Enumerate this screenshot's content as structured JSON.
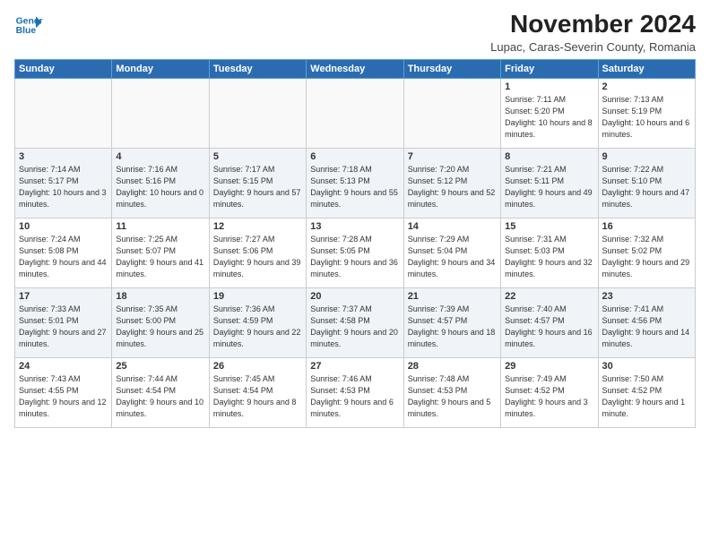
{
  "header": {
    "logo_line1": "General",
    "logo_line2": "Blue",
    "month_title": "November 2024",
    "subtitle": "Lupac, Caras-Severin County, Romania"
  },
  "weekdays": [
    "Sunday",
    "Monday",
    "Tuesday",
    "Wednesday",
    "Thursday",
    "Friday",
    "Saturday"
  ],
  "weeks": [
    [
      {
        "day": "",
        "info": ""
      },
      {
        "day": "",
        "info": ""
      },
      {
        "day": "",
        "info": ""
      },
      {
        "day": "",
        "info": ""
      },
      {
        "day": "",
        "info": ""
      },
      {
        "day": "1",
        "info": "Sunrise: 7:11 AM\nSunset: 5:20 PM\nDaylight: 10 hours\nand 8 minutes."
      },
      {
        "day": "2",
        "info": "Sunrise: 7:13 AM\nSunset: 5:19 PM\nDaylight: 10 hours\nand 6 minutes."
      }
    ],
    [
      {
        "day": "3",
        "info": "Sunrise: 7:14 AM\nSunset: 5:17 PM\nDaylight: 10 hours\nand 3 minutes."
      },
      {
        "day": "4",
        "info": "Sunrise: 7:16 AM\nSunset: 5:16 PM\nDaylight: 10 hours\nand 0 minutes."
      },
      {
        "day": "5",
        "info": "Sunrise: 7:17 AM\nSunset: 5:15 PM\nDaylight: 9 hours\nand 57 minutes."
      },
      {
        "day": "6",
        "info": "Sunrise: 7:18 AM\nSunset: 5:13 PM\nDaylight: 9 hours\nand 55 minutes."
      },
      {
        "day": "7",
        "info": "Sunrise: 7:20 AM\nSunset: 5:12 PM\nDaylight: 9 hours\nand 52 minutes."
      },
      {
        "day": "8",
        "info": "Sunrise: 7:21 AM\nSunset: 5:11 PM\nDaylight: 9 hours\nand 49 minutes."
      },
      {
        "day": "9",
        "info": "Sunrise: 7:22 AM\nSunset: 5:10 PM\nDaylight: 9 hours\nand 47 minutes."
      }
    ],
    [
      {
        "day": "10",
        "info": "Sunrise: 7:24 AM\nSunset: 5:08 PM\nDaylight: 9 hours\nand 44 minutes."
      },
      {
        "day": "11",
        "info": "Sunrise: 7:25 AM\nSunset: 5:07 PM\nDaylight: 9 hours\nand 41 minutes."
      },
      {
        "day": "12",
        "info": "Sunrise: 7:27 AM\nSunset: 5:06 PM\nDaylight: 9 hours\nand 39 minutes."
      },
      {
        "day": "13",
        "info": "Sunrise: 7:28 AM\nSunset: 5:05 PM\nDaylight: 9 hours\nand 36 minutes."
      },
      {
        "day": "14",
        "info": "Sunrise: 7:29 AM\nSunset: 5:04 PM\nDaylight: 9 hours\nand 34 minutes."
      },
      {
        "day": "15",
        "info": "Sunrise: 7:31 AM\nSunset: 5:03 PM\nDaylight: 9 hours\nand 32 minutes."
      },
      {
        "day": "16",
        "info": "Sunrise: 7:32 AM\nSunset: 5:02 PM\nDaylight: 9 hours\nand 29 minutes."
      }
    ],
    [
      {
        "day": "17",
        "info": "Sunrise: 7:33 AM\nSunset: 5:01 PM\nDaylight: 9 hours\nand 27 minutes."
      },
      {
        "day": "18",
        "info": "Sunrise: 7:35 AM\nSunset: 5:00 PM\nDaylight: 9 hours\nand 25 minutes."
      },
      {
        "day": "19",
        "info": "Sunrise: 7:36 AM\nSunset: 4:59 PM\nDaylight: 9 hours\nand 22 minutes."
      },
      {
        "day": "20",
        "info": "Sunrise: 7:37 AM\nSunset: 4:58 PM\nDaylight: 9 hours\nand 20 minutes."
      },
      {
        "day": "21",
        "info": "Sunrise: 7:39 AM\nSunset: 4:57 PM\nDaylight: 9 hours\nand 18 minutes."
      },
      {
        "day": "22",
        "info": "Sunrise: 7:40 AM\nSunset: 4:57 PM\nDaylight: 9 hours\nand 16 minutes."
      },
      {
        "day": "23",
        "info": "Sunrise: 7:41 AM\nSunset: 4:56 PM\nDaylight: 9 hours\nand 14 minutes."
      }
    ],
    [
      {
        "day": "24",
        "info": "Sunrise: 7:43 AM\nSunset: 4:55 PM\nDaylight: 9 hours\nand 12 minutes."
      },
      {
        "day": "25",
        "info": "Sunrise: 7:44 AM\nSunset: 4:54 PM\nDaylight: 9 hours\nand 10 minutes."
      },
      {
        "day": "26",
        "info": "Sunrise: 7:45 AM\nSunset: 4:54 PM\nDaylight: 9 hours\nand 8 minutes."
      },
      {
        "day": "27",
        "info": "Sunrise: 7:46 AM\nSunset: 4:53 PM\nDaylight: 9 hours\nand 6 minutes."
      },
      {
        "day": "28",
        "info": "Sunrise: 7:48 AM\nSunset: 4:53 PM\nDaylight: 9 hours\nand 5 minutes."
      },
      {
        "day": "29",
        "info": "Sunrise: 7:49 AM\nSunset: 4:52 PM\nDaylight: 9 hours\nand 3 minutes."
      },
      {
        "day": "30",
        "info": "Sunrise: 7:50 AM\nSunset: 4:52 PM\nDaylight: 9 hours\nand 1 minute."
      }
    ]
  ]
}
